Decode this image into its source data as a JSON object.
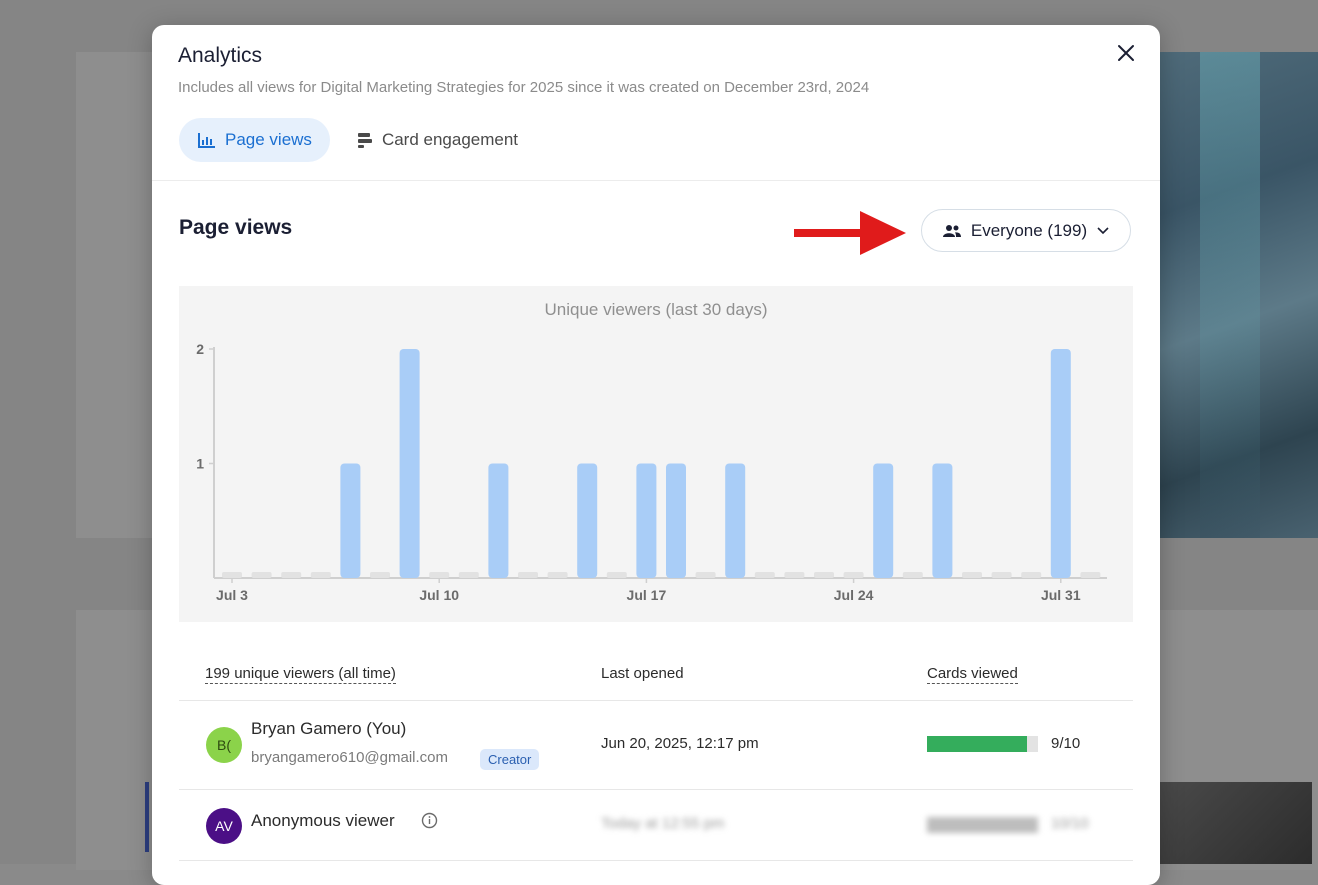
{
  "modal": {
    "title": "Analytics",
    "subtitle": "Includes all views for Digital Marketing Strategies for 2025 since it was created on December 23rd, 2024",
    "tabs": [
      {
        "label": "Page views",
        "icon": "bar-chart-icon",
        "active": true
      },
      {
        "label": "Card engagement",
        "icon": "cards-icon",
        "active": false
      }
    ]
  },
  "page_views": {
    "heading": "Page views",
    "audience_filter": {
      "label": "Everyone (199)",
      "icon": "people-icon"
    }
  },
  "chart_data": {
    "type": "bar",
    "title": "Unique viewers (last 30 days)",
    "x_tick_labels": [
      "Jul 3",
      "Jul 10",
      "Jul 17",
      "Jul 24",
      "Jul 31"
    ],
    "categories": [
      "Jul 3",
      "Jul 4",
      "Jul 5",
      "Jul 6",
      "Jul 7",
      "Jul 8",
      "Jul 9",
      "Jul 10",
      "Jul 11",
      "Jul 12",
      "Jul 13",
      "Jul 14",
      "Jul 15",
      "Jul 16",
      "Jul 17",
      "Jul 18",
      "Jul 19",
      "Jul 20",
      "Jul 21",
      "Jul 22",
      "Jul 23",
      "Jul 24",
      "Jul 25",
      "Jul 26",
      "Jul 27",
      "Jul 28",
      "Jul 29",
      "Jul 30",
      "Jul 31",
      "Aug 1"
    ],
    "values": [
      0,
      0,
      0,
      0,
      1,
      0,
      2,
      0,
      0,
      1,
      0,
      0,
      1,
      0,
      1,
      1,
      0,
      1,
      0,
      0,
      0,
      0,
      1,
      0,
      1,
      0,
      0,
      0,
      2,
      0
    ],
    "y_ticks": [
      1,
      2
    ],
    "ylim": [
      0,
      2
    ],
    "colors": {
      "bar": "#a9cdf7",
      "zero_bar": "#e2e2e2"
    }
  },
  "viewers_table": {
    "headers": {
      "viewers": "199 unique viewers (all time)",
      "last_opened": "Last opened",
      "cards_viewed": "Cards viewed"
    },
    "rows": [
      {
        "initials": "B(",
        "avatar_color": "#8bd34a",
        "name": "Bryan Gamero (You)",
        "email": "bryangamero610@gmail.com",
        "badge": "Creator",
        "last_opened": "Jun 20, 2025, 12:17 pm",
        "cards_viewed": "9/10",
        "progress": 0.9
      },
      {
        "initials": "AV",
        "avatar_color": "#4b0f86",
        "name": "Anonymous viewer",
        "last_opened": "Today at 12:55 pm",
        "cards_viewed": "10/10",
        "progress": 1.0
      }
    ]
  }
}
